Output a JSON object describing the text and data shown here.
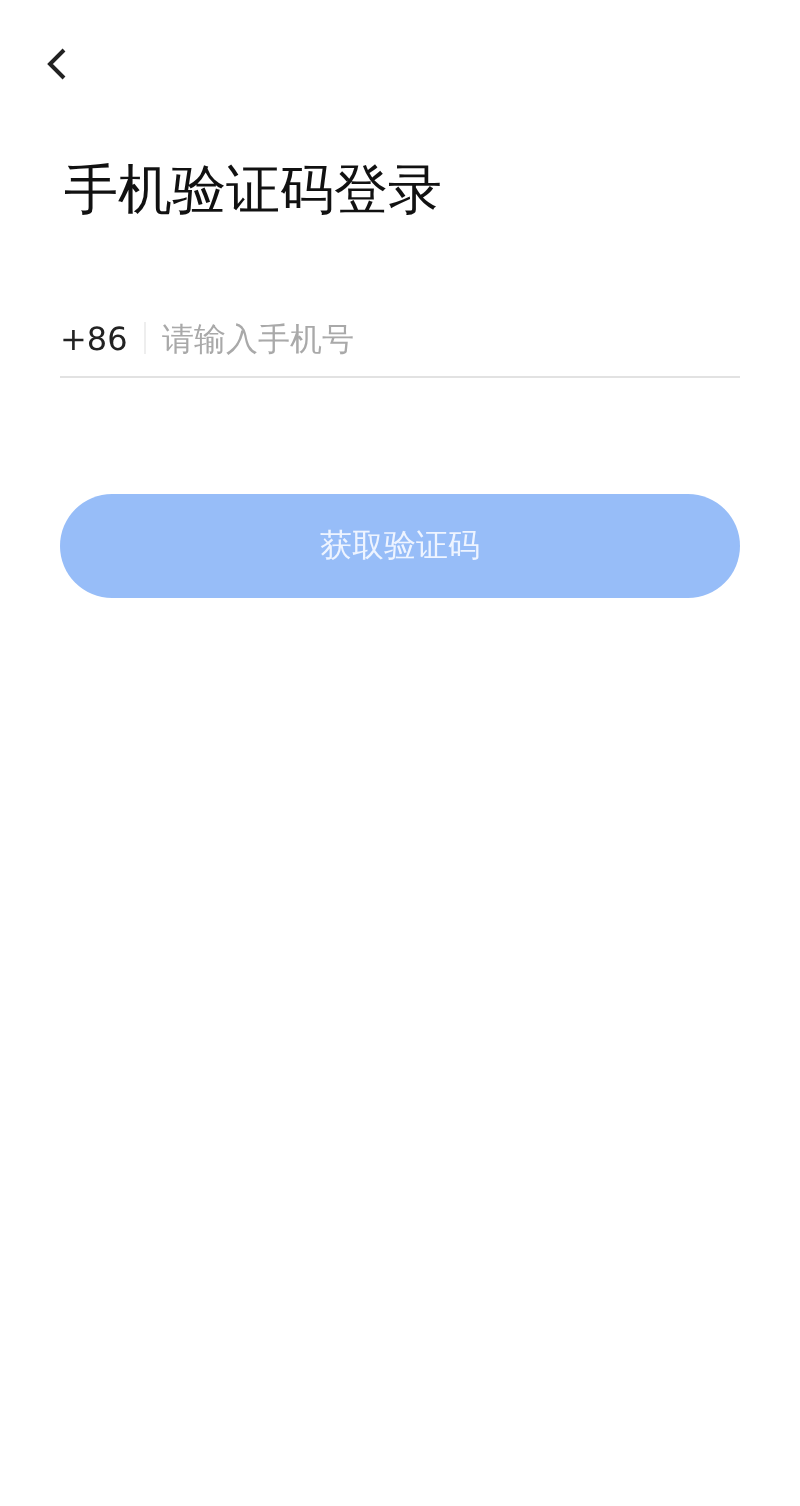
{
  "title": "手机验证码登录",
  "phone": {
    "country_code": "+86",
    "placeholder": "请输入手机号"
  },
  "submit": {
    "label": "获取验证码",
    "disabled": true
  }
}
